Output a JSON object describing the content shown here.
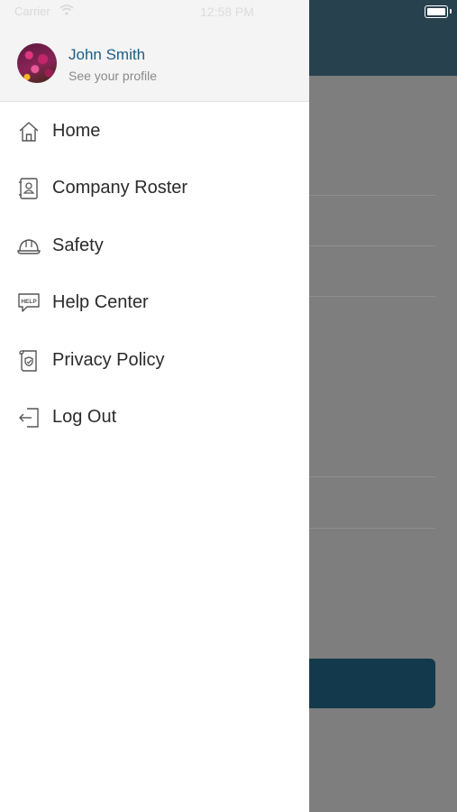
{
  "status_bar": {
    "carrier": "Carrier",
    "time": "12:58 PM"
  },
  "profile": {
    "name": "John Smith",
    "subtitle": "See your profile"
  },
  "menu": {
    "items": [
      {
        "label": "Home",
        "icon": "home-icon"
      },
      {
        "label": "Company Roster",
        "icon": "contact-book-icon"
      },
      {
        "label": "Safety",
        "icon": "hard-hat-icon"
      },
      {
        "label": "Help Center",
        "icon": "help-bubble-icon"
      },
      {
        "label": "Privacy Policy",
        "icon": "policy-scroll-icon"
      },
      {
        "label": "Log Out",
        "icon": "logout-icon"
      }
    ]
  },
  "colors": {
    "accent": "#1a5d86",
    "header_bg": "#27414f",
    "button_bg": "#13394c"
  }
}
